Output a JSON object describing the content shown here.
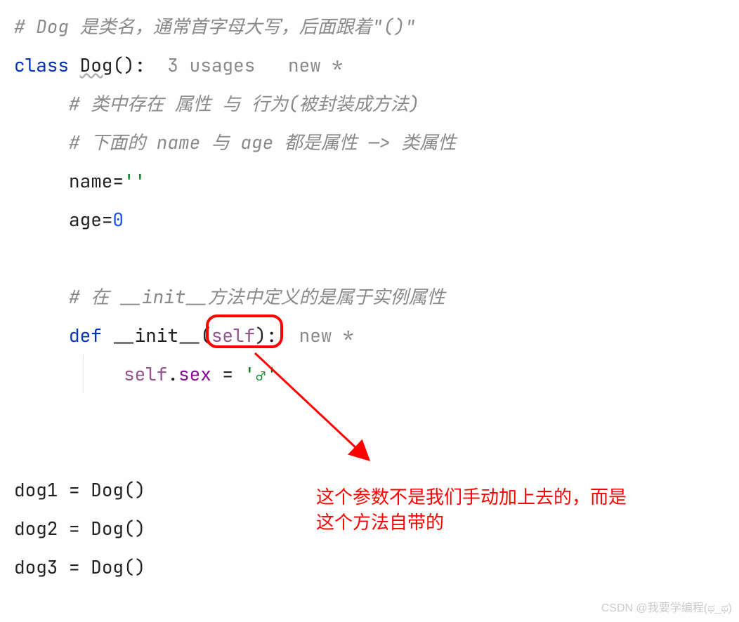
{
  "lines": {
    "l1_comment": "# Dog 是类名，通常首字母大写，后面跟着\"()\"",
    "l2_keyword": "class ",
    "l2_classname": "Dog",
    "l2_parens": "()",
    "l2_colon": ":",
    "l2_hint_usages": "  3 usages   ",
    "l2_hint_new": "new *",
    "l3_comment": "# 类中存在 属性 与 行为(被封装成方法)",
    "l4_comment": "# 下面的 name 与 age 都是属性 —> 类属性",
    "l5_name_ident": "name",
    "l5_eq": "=",
    "l5_str": "''",
    "l6_age_ident": "age",
    "l6_eq": "=",
    "l6_num": "0",
    "l7_comment": "# 在 __init__方法中定义的是属于实例属性",
    "l8_keyword": "def ",
    "l8_func": "__init__",
    "l8_open": "(",
    "l8_self": "self",
    "l8_close": ")",
    "l8_colon": ":",
    "l8_hint": "  new *",
    "l9_self": "self",
    "l9_dot": ".",
    "l9_attr": "sex",
    "l9_eq": " = ",
    "l9_str": "'♂'",
    "l10_ident": "dog1",
    "l10_eq": " = ",
    "l10_call": "Dog()",
    "l11_ident": "dog2",
    "l11_eq": " = ",
    "l11_call": "Dog()",
    "l12_ident": "dog3",
    "l12_eq": " = ",
    "l12_call": "Dog()"
  },
  "annotation": {
    "line1": "这个参数不是我们手动加上去的，而是",
    "line2": "这个方法自带的"
  },
  "watermark": "CSDN @我要学编程(ಥ_ಥ)"
}
